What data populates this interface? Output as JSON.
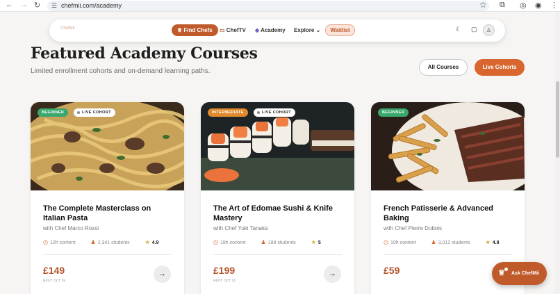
{
  "browser": {
    "url": "chefmii.com/academy"
  },
  "nav": {
    "logo": "ChefMii",
    "find_chefs": "Find Chefs",
    "chef_tv": "ChefTV",
    "academy": "Academy",
    "explore": "Explore",
    "waitlist": "Waitlist"
  },
  "header": {
    "title": "Featured Academy Courses",
    "subtitle": "Limited enrollment cohorts and on-demand learning paths.",
    "all_courses": "All Courses",
    "live_cohorts": "Live Cohorts"
  },
  "courses": [
    {
      "level": "BEGINNER",
      "level_color": "#3aa76d",
      "live": "LIVE COHORT",
      "title": "The Complete Masterclass on Italian Pasta",
      "chef": "with Chef Marco Rossi",
      "hours": "12h content",
      "students": "2,341 students",
      "rating": "4.9",
      "price": "£149",
      "next": "NEXT: OCT 15"
    },
    {
      "level": "INTERMEDIATE",
      "level_color": "#e08a2c",
      "live": "LIVE COHORT",
      "title": "The Art of Edomae Sushi & Knife Mastery",
      "chef": "with Chef Yuki Tanaka",
      "hours": "18h content",
      "students": "189 students",
      "rating": "5",
      "price": "£199",
      "next": "NEXT: OCT 22"
    },
    {
      "level": "BEGINNER",
      "level_color": "#3aa76d",
      "title": "French Patisserie & Advanced Baking",
      "chef": "with Chef Pierre Dubois",
      "hours": "10h content",
      "students": "3,012 students",
      "rating": "4.8",
      "price": "£59"
    }
  ],
  "ask": {
    "label": "Ask ChefMii"
  },
  "colors": {
    "accent": "#c05a2a",
    "accent_light": "#d9652f"
  }
}
